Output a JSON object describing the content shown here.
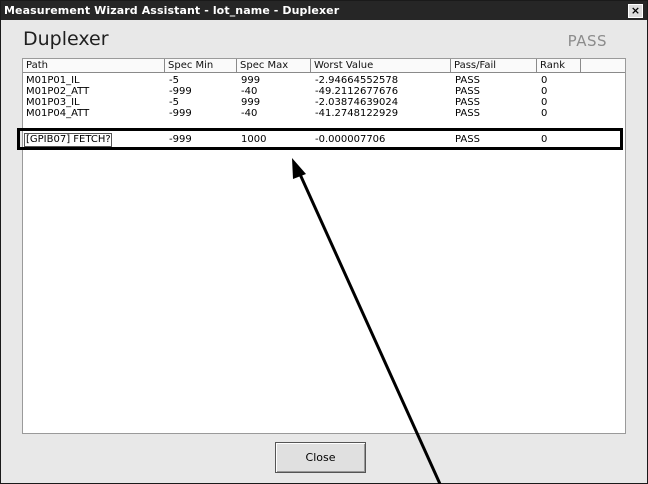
{
  "window": {
    "title": "Measurement Wizard Assistant - lot_name - Duplexer",
    "close_glyph": "×"
  },
  "heading": "Duplexer",
  "status": "PASS",
  "table": {
    "columns": [
      "Path",
      "Spec Min",
      "Spec Max",
      "Worst Value",
      "Pass/Fail",
      "Rank"
    ],
    "rows": [
      {
        "path": "M01P01_IL",
        "spec_min": "-5",
        "spec_max": "999",
        "worst": "-2.94664552578",
        "result": "PASS",
        "rank": "0"
      },
      {
        "path": "M01P02_ATT",
        "spec_min": "-999",
        "spec_max": "-40",
        "worst": "-49.2112677676",
        "result": "PASS",
        "rank": "0"
      },
      {
        "path": "M01P03_IL",
        "spec_min": "-5",
        "spec_max": "999",
        "worst": "-2.03874639024",
        "result": "PASS",
        "rank": "0"
      },
      {
        "path": "M01P04_ATT",
        "spec_min": "-999",
        "spec_max": "-40",
        "worst": "-41.2748122929",
        "result": "PASS",
        "rank": "0"
      },
      {
        "path": "[GPIB07] FETCH?",
        "spec_min": "-999",
        "spec_max": "1000",
        "worst": "-0.000007706",
        "result": "PASS",
        "rank": "0"
      }
    ]
  },
  "buttons": {
    "close": "Close"
  }
}
